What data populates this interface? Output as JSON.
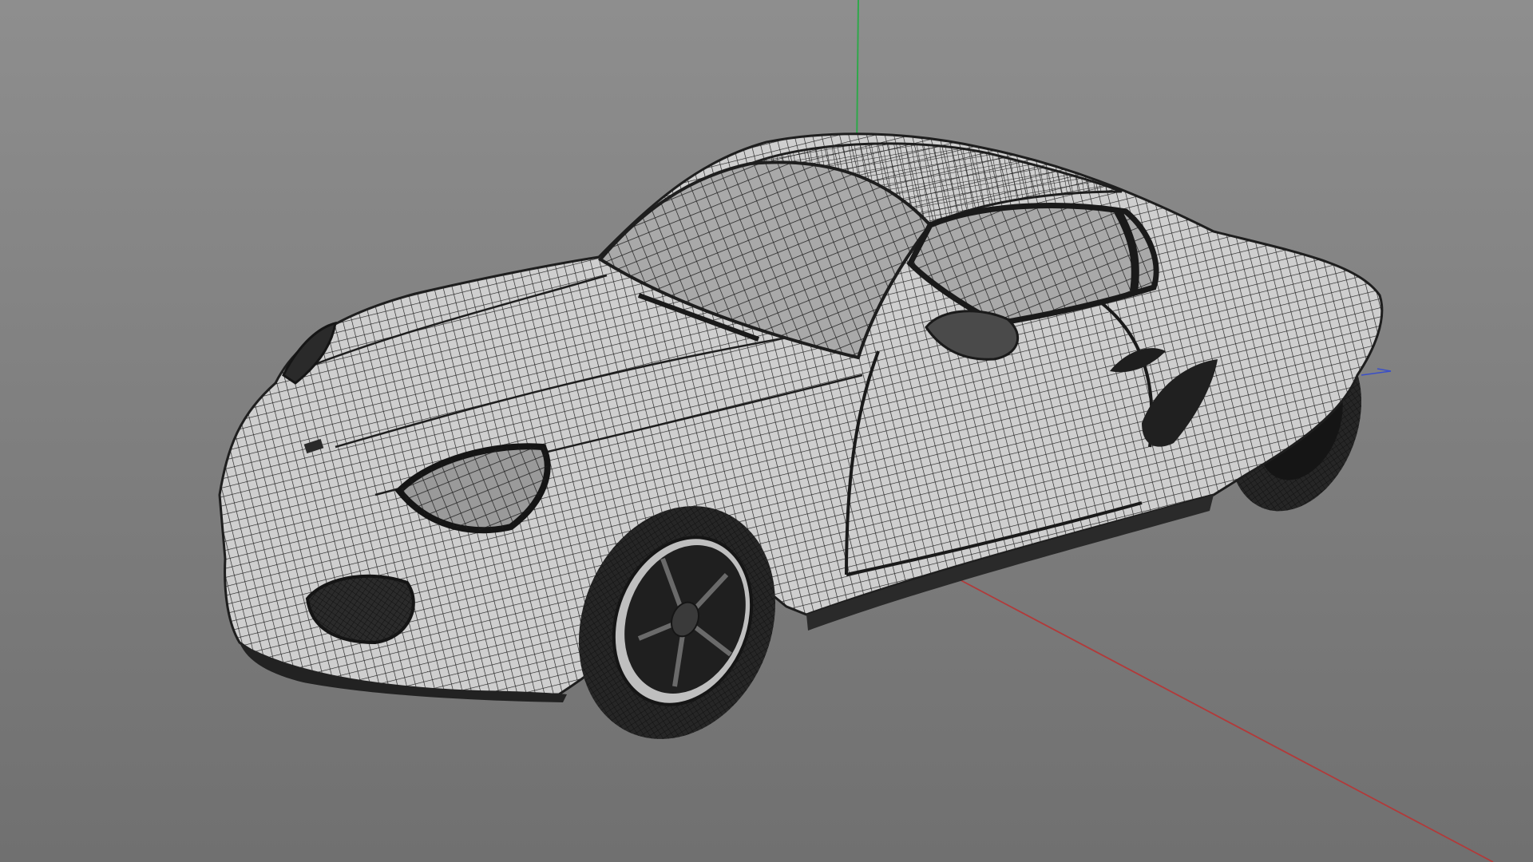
{
  "viewport": {
    "background_top": "#8e8e8e",
    "background_bottom": "#707070"
  },
  "axes": {
    "x_axis_color": "#b23a3a",
    "y_axis_color": "#2fa84a",
    "z_axis_color": "#3a4fc8"
  },
  "model": {
    "icon": "wireframe-sports-car",
    "display_mode": "wireframe",
    "body_fill": "#cfcfcf",
    "wire_color": "#1e1e1e",
    "tire_color": "#262626",
    "glass_fill": "#a9a9a9"
  }
}
